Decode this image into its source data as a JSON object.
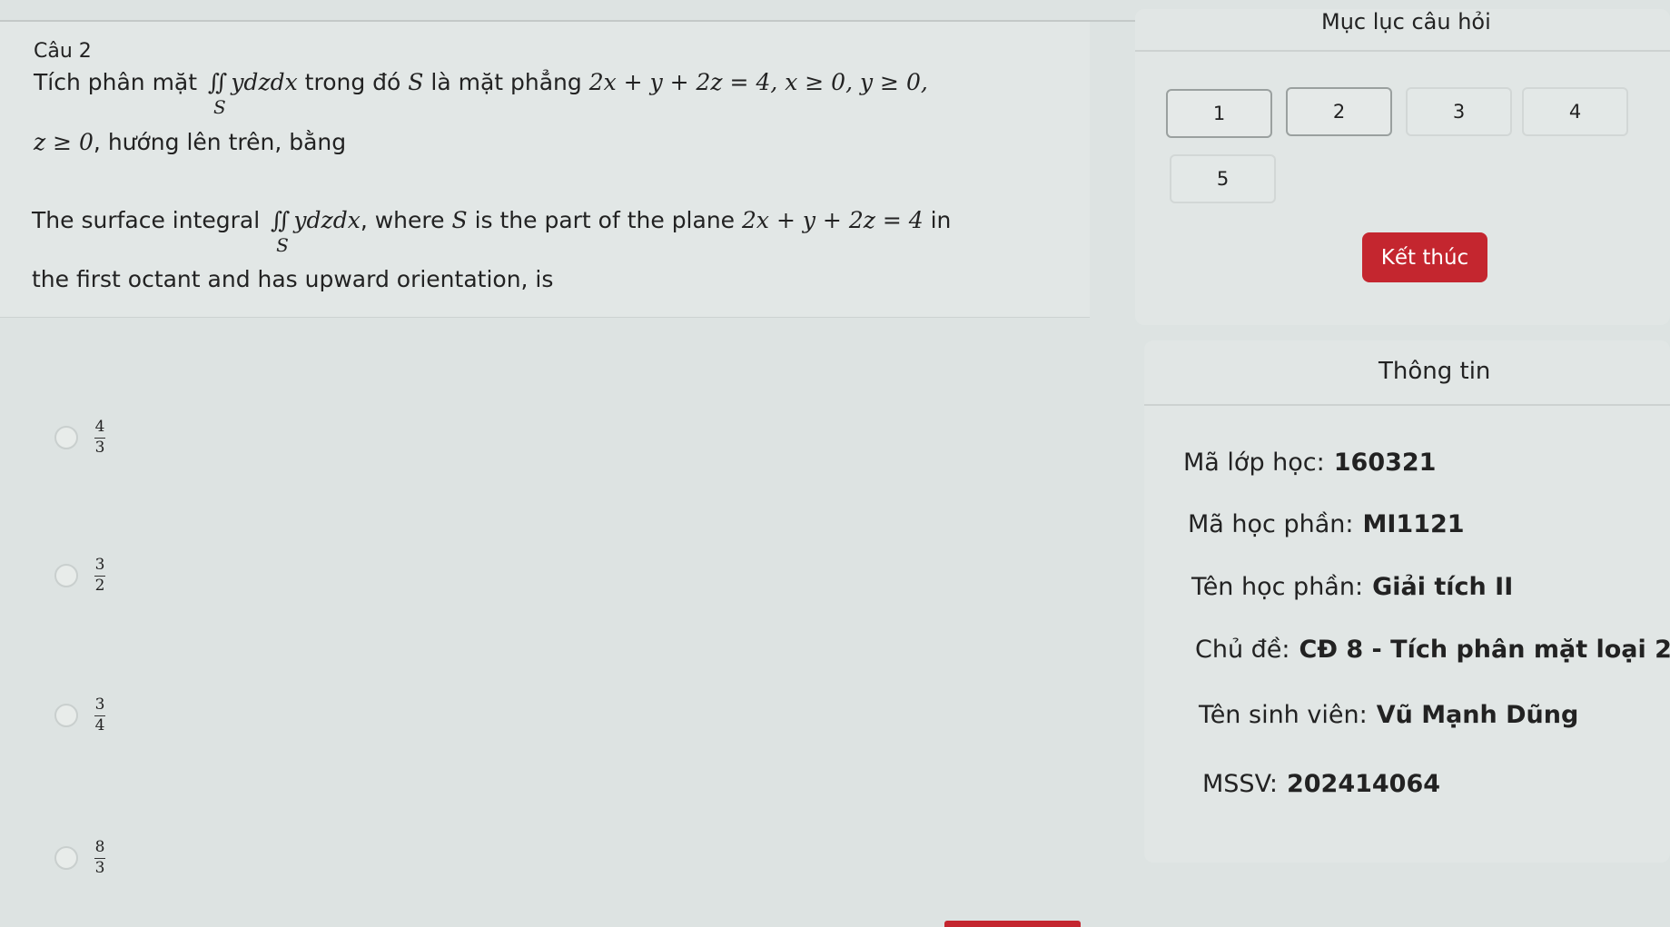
{
  "question": {
    "label": "Câu 2",
    "vi_line1_prefix": "Tích phân mặt",
    "integrand": "ydzdx",
    "surface": "S",
    "vi_line1_mid": "trong đó",
    "vi_line1_mid2": "là mặt phẳng",
    "vi_line1_eq": "2x + y + 2z = 4, x ≥ 0, y ≥ 0,",
    "vi_line2_eq": "z ≥ 0",
    "vi_line2_suffix": ", hướng lên trên, bằng",
    "en_line1_prefix": "The surface integral",
    "en_line1_mid": ", where",
    "en_line1_mid2": "is the part of the plane",
    "en_line1_eq": "2x + y + 2z = 4",
    "en_line1_suffix": "in",
    "en_line2": "the first octant and has upward orientation, is"
  },
  "answers": [
    {
      "num": "4",
      "den": "3"
    },
    {
      "num": "3",
      "den": "2"
    },
    {
      "num": "3",
      "den": "4"
    },
    {
      "num": "8",
      "den": "3"
    }
  ],
  "index": {
    "title": "Mục lục câu hỏi",
    "buttons": [
      "1",
      "2",
      "3",
      "4",
      "5"
    ],
    "finish_label": "Kết thúc"
  },
  "info": {
    "title": "Thông tin",
    "rows": [
      {
        "label": "Mã lớp học:",
        "value": "160321"
      },
      {
        "label": "Mã học phần:",
        "value": "MI1121"
      },
      {
        "label": "Tên học phần:",
        "value": "Giải tích II"
      },
      {
        "label": "Chủ đề:",
        "value": "CĐ 8 - Tích phân mặt loại 2"
      },
      {
        "label": "Tên sinh viên:",
        "value": "Vũ Mạnh Dũng"
      },
      {
        "label": "MSSV:",
        "value": "202414064"
      }
    ]
  },
  "colors": {
    "accent": "#c4262f"
  }
}
